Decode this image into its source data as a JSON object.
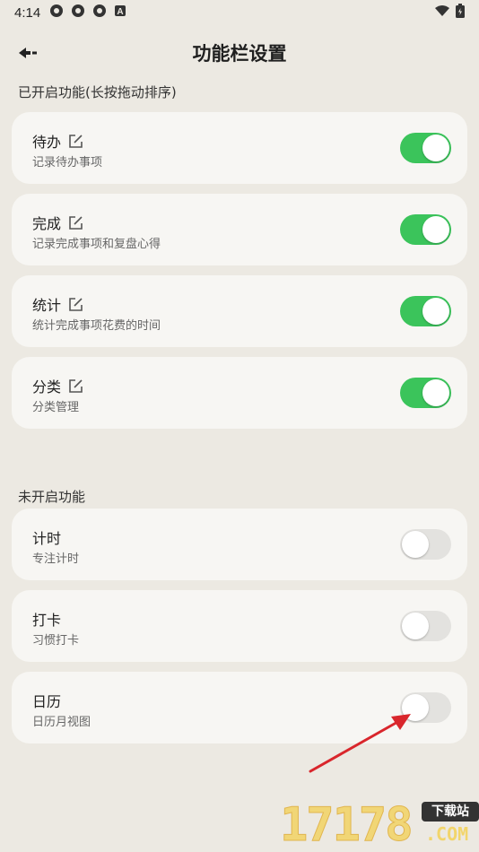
{
  "status_bar": {
    "time": "4:14",
    "icons": [
      "notification-icon",
      "notification-icon",
      "notification-icon",
      "a-icon"
    ],
    "right_icons": [
      "wifi-icon",
      "battery-icon"
    ]
  },
  "header": {
    "title": "功能栏设置",
    "back_icon": "back-arrow-icon"
  },
  "enabled_section": {
    "title": "已开启功能(长按拖动排序)",
    "items": [
      {
        "name": "待办",
        "desc": "记录待办事项",
        "enabled": true
      },
      {
        "name": "完成",
        "desc": "记录完成事项和复盘心得",
        "enabled": true
      },
      {
        "name": "统计",
        "desc": "统计完成事项花费的时间",
        "enabled": true
      },
      {
        "name": "分类",
        "desc": "分类管理",
        "enabled": true
      }
    ]
  },
  "disabled_section": {
    "title": "未开启功能",
    "items": [
      {
        "name": "计时",
        "desc": "专注计时",
        "enabled": false
      },
      {
        "name": "打卡",
        "desc": "习惯打卡",
        "enabled": false
      },
      {
        "name": "日历",
        "desc": "日历月视图",
        "enabled": false
      }
    ]
  },
  "watermark": {
    "number": "17178",
    "badge": "下载站",
    "suffix": ".COM"
  },
  "colors": {
    "background": "#ECE9E2",
    "card": "#F7F6F3",
    "toggle_on": "#3BC45B",
    "toggle_off": "#E3E2DF",
    "annotation_arrow": "#D9262C"
  }
}
